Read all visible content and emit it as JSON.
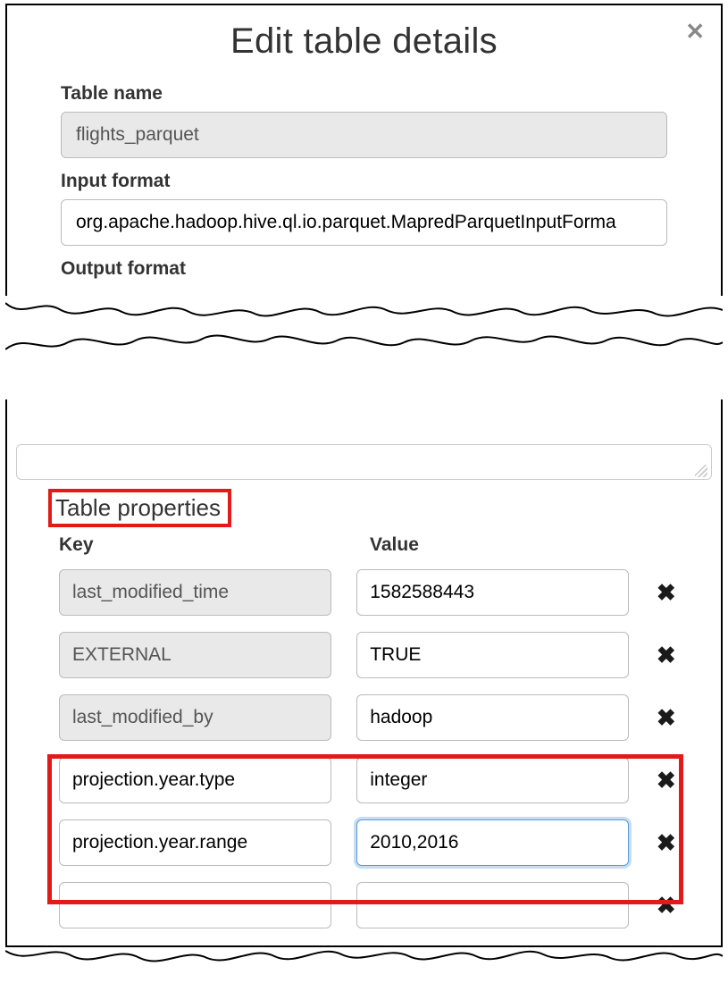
{
  "dialog": {
    "title": "Edit table details"
  },
  "fields": {
    "table_name_label": "Table name",
    "table_name_value": "flights_parquet",
    "input_format_label": "Input format",
    "input_format_value": "org.apache.hadoop.hive.ql.io.parquet.MapredParquetInputForma",
    "output_format_label": "Output format"
  },
  "table_properties": {
    "heading": "Table properties",
    "key_header": "Key",
    "value_header": "Value",
    "rows": [
      {
        "key": "last_modified_time",
        "value": "1582588443",
        "key_readonly": true
      },
      {
        "key": "EXTERNAL",
        "value": "TRUE",
        "key_readonly": true
      },
      {
        "key": "last_modified_by",
        "value": "hadoop",
        "key_readonly": true
      },
      {
        "key": "projection.year.type",
        "value": "integer",
        "key_readonly": false
      },
      {
        "key": "projection.year.range",
        "value": "2010,2016",
        "key_readonly": false,
        "value_focused": true
      },
      {
        "key": "",
        "value": "",
        "key_readonly": false
      }
    ]
  }
}
